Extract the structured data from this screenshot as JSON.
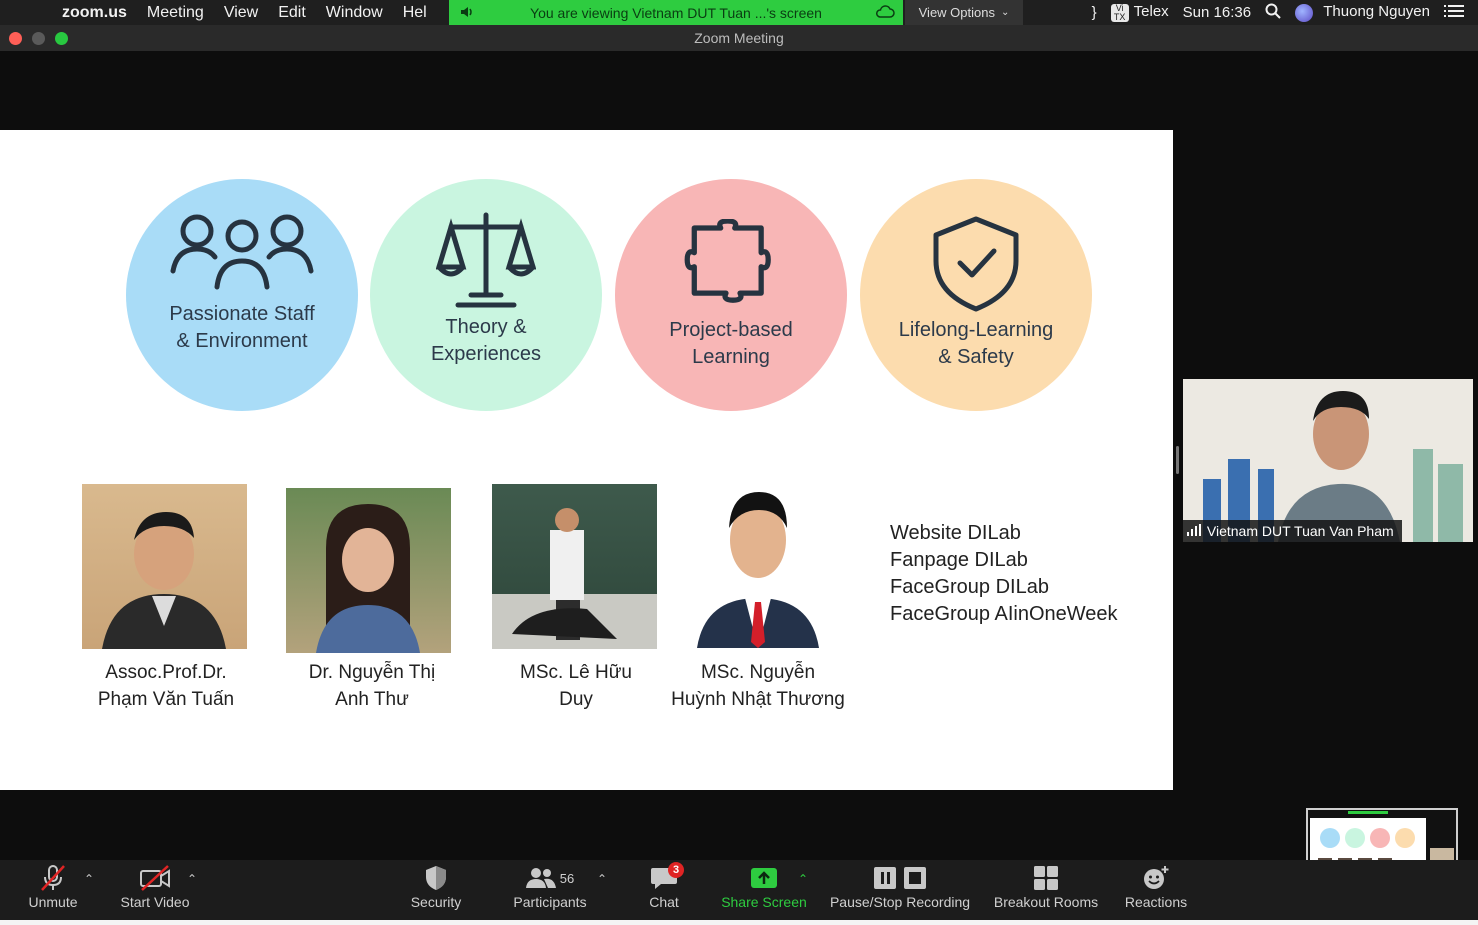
{
  "menubar": {
    "app": "zoom.us",
    "items": [
      "Meeting",
      "View",
      "Edit",
      "Window",
      "Hel"
    ],
    "share_banner": "You are viewing Vietnam DUT Tuan ...'s screen",
    "view_options": "View Options",
    "input_method": "Telex",
    "telex_badge": "Vi\nTX",
    "clock": "Sun 16:36",
    "user": "Thuong Nguyen"
  },
  "window": {
    "title": "Zoom Meeting"
  },
  "slide": {
    "circles": [
      {
        "text": "Passionate Staff\n& Environment",
        "color": "#a9dcf7",
        "icon": "people-icon"
      },
      {
        "text": "Theory &\nExperiences",
        "color": "#c9f5e0",
        "icon": "scale-icon"
      },
      {
        "text": "Project-based\nLearning",
        "color": "#f8b6b6",
        "icon": "puzzle-icon"
      },
      {
        "text": "Lifelong-Learning\n& Safety",
        "color": "#fcdcae",
        "icon": "shield-check-icon"
      }
    ],
    "people": [
      {
        "name": "Assoc.Prof.Dr.\nPhạm Văn Tuấn"
      },
      {
        "name": "Dr. Nguyễn Thị\nAnh Thư"
      },
      {
        "name": "MSc. Lê Hữu\nDuy"
      },
      {
        "name": "MSc. Nguyễn\nHuỳnh Nhật Thương"
      }
    ],
    "links": [
      "Website DILab",
      "Fanpage DILab",
      "FaceGroup DILab",
      "FaceGroup AIinOneWeek"
    ]
  },
  "speaker": {
    "name": "Vietnam DUT Tuan Van Pham"
  },
  "toolbar": {
    "unmute": "Unmute",
    "start_video": "Start Video",
    "security": "Security",
    "participants": "Participants",
    "participants_count": "56",
    "chat": "Chat",
    "chat_badge": "3",
    "share_screen": "Share Screen",
    "recording": "Pause/Stop Recording",
    "breakout": "Breakout Rooms",
    "reactions": "Reactions"
  },
  "colors": {
    "share_green": "#2ecc40",
    "toolbar_bg": "#1c1c1c",
    "badge_red": "#e02424"
  }
}
